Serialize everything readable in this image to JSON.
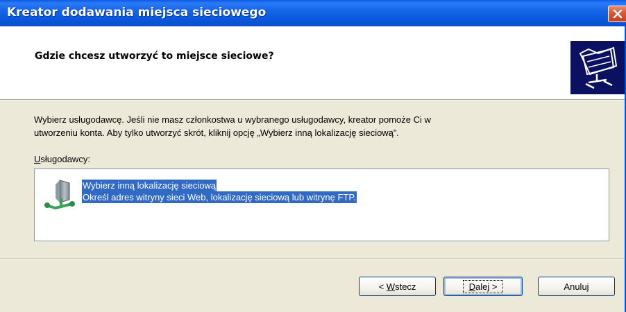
{
  "window": {
    "title": "Kreator dodawania miejsca sieciowego"
  },
  "header": {
    "title": "Gdzie chcesz utworzyć to miejsce sieciowe?",
    "icon": "network-folder-icon"
  },
  "body": {
    "description_line1": "Wybierz usługodawcę. Jeśli nie masz członkostwa u wybranego usługodawcy, kreator pomoże Ci w",
    "description_line2": "utworzeniu konta. Aby tylko utworzyć skrót, kliknij opcję „Wybierz inną lokalizację sieciową”.",
    "list_label_accel": "U",
    "list_label_rest": "sługodawcy:",
    "providers": [
      {
        "title": "Wybierz inną lokalizację sieciową",
        "subtitle": "Określ adres witryny sieci Web, lokalizację sieciową lub witrynę FTP.",
        "icon": "network-place-icon",
        "selected": true
      }
    ]
  },
  "buttons": {
    "back_prefix": "< ",
    "back_accel": "W",
    "back_rest": "stecz",
    "next_accel": "D",
    "next_rest": "alej >",
    "cancel": "Anuluj"
  },
  "colors": {
    "titlebar": "#0a58dc",
    "selection": "#316ac5",
    "dialog_bg": "#ece9d8",
    "close_button": "#d95b3c"
  }
}
